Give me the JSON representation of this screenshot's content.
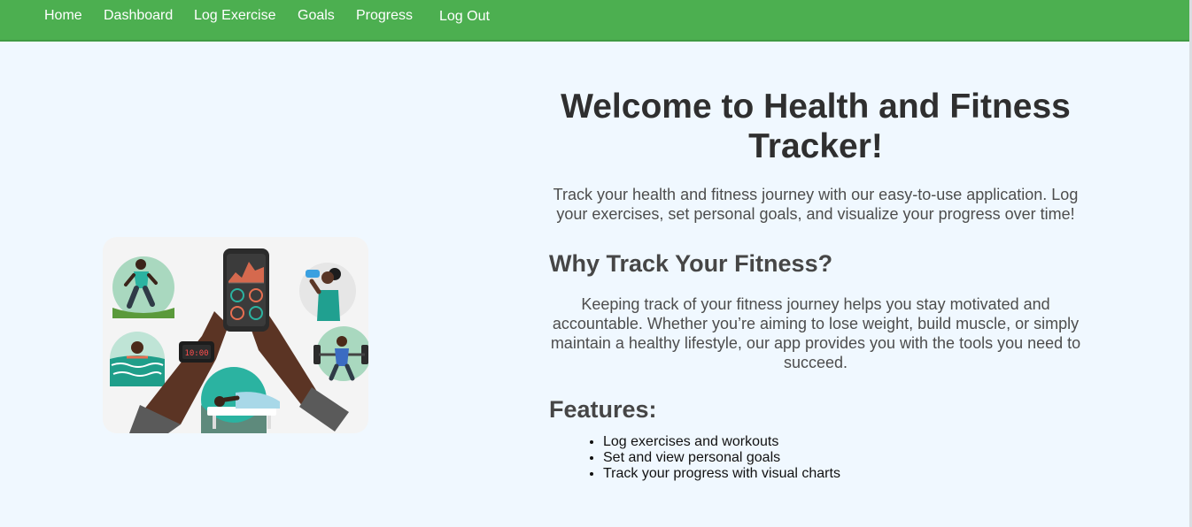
{
  "nav": {
    "items": [
      "Home",
      "Dashboard",
      "Log Exercise",
      "Goals",
      "Progress",
      "Log Out"
    ]
  },
  "hero": {
    "title": "Welcome to Health and Fitness Tracker!",
    "intro": "Track your health and fitness journey with our easy-to-use application. Log your exercises, set personal goals, and visualize your progress over time!",
    "phone_display": "10:00"
  },
  "why": {
    "heading": "Why Track Your Fitness?",
    "text": "Keeping track of your fitness journey helps you stay motivated and accountable. Whether you’re aiming to lose weight, build muscle, or simply maintain a healthy lifestyle, our app provides you with the tools you need to succeed."
  },
  "features": {
    "heading": "Features:",
    "items": [
      "Log exercises and workouts",
      "Set and view personal goals",
      "Track your progress with visual charts"
    ]
  },
  "colors": {
    "navbar": "#4caf50",
    "background": "#f0f8ff"
  }
}
